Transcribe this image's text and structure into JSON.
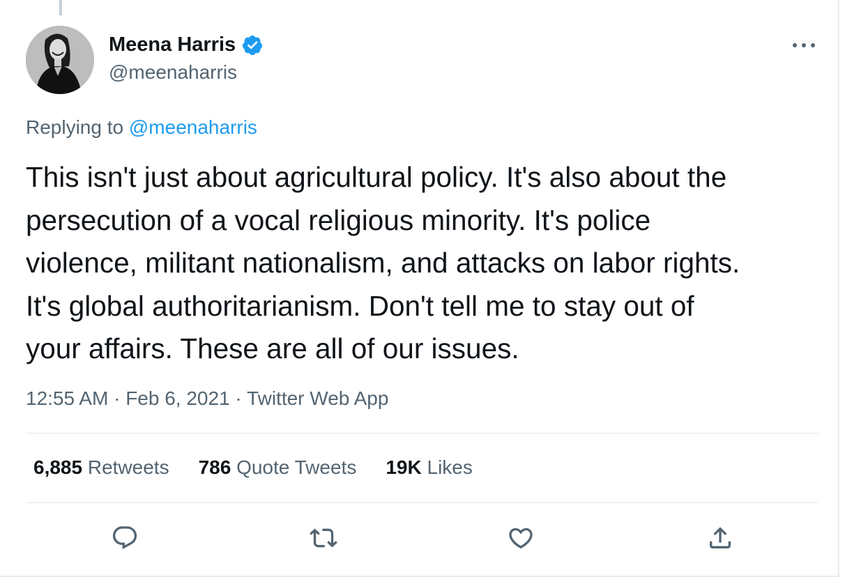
{
  "tweet": {
    "author": {
      "name": "Meena Harris",
      "handle": "@meenaharris",
      "verified": true
    },
    "replying_prefix": "Replying to ",
    "replying_to": "@meenaharris",
    "text": "This isn't just about agricultural policy. It's also about the\npersecution of a vocal religious minority. It's police\nviolence, militant nationalism, and attacks on labor rights.\nIt's global authoritarianism. Don't tell me to stay out of\nyour affairs. These are all of our issues.",
    "time": "12:55 AM",
    "separator": " · ",
    "date": "Feb 6, 2021",
    "source": "Twitter Web App",
    "stats": {
      "retweets": {
        "count": "6,885",
        "label": "Retweets"
      },
      "quotes": {
        "count": "786",
        "label": "Quote Tweets"
      },
      "likes": {
        "count": "19K",
        "label": "Likes"
      }
    }
  },
  "colors": {
    "accent": "#1d9bf0",
    "secondary_text": "#536471",
    "primary_text": "#0f1419"
  },
  "icons": {
    "more": "more-horizontal-icon",
    "reply": "reply-icon",
    "retweet": "retweet-icon",
    "like": "heart-icon",
    "share": "share-icon",
    "verified": "verified-badge-icon"
  }
}
